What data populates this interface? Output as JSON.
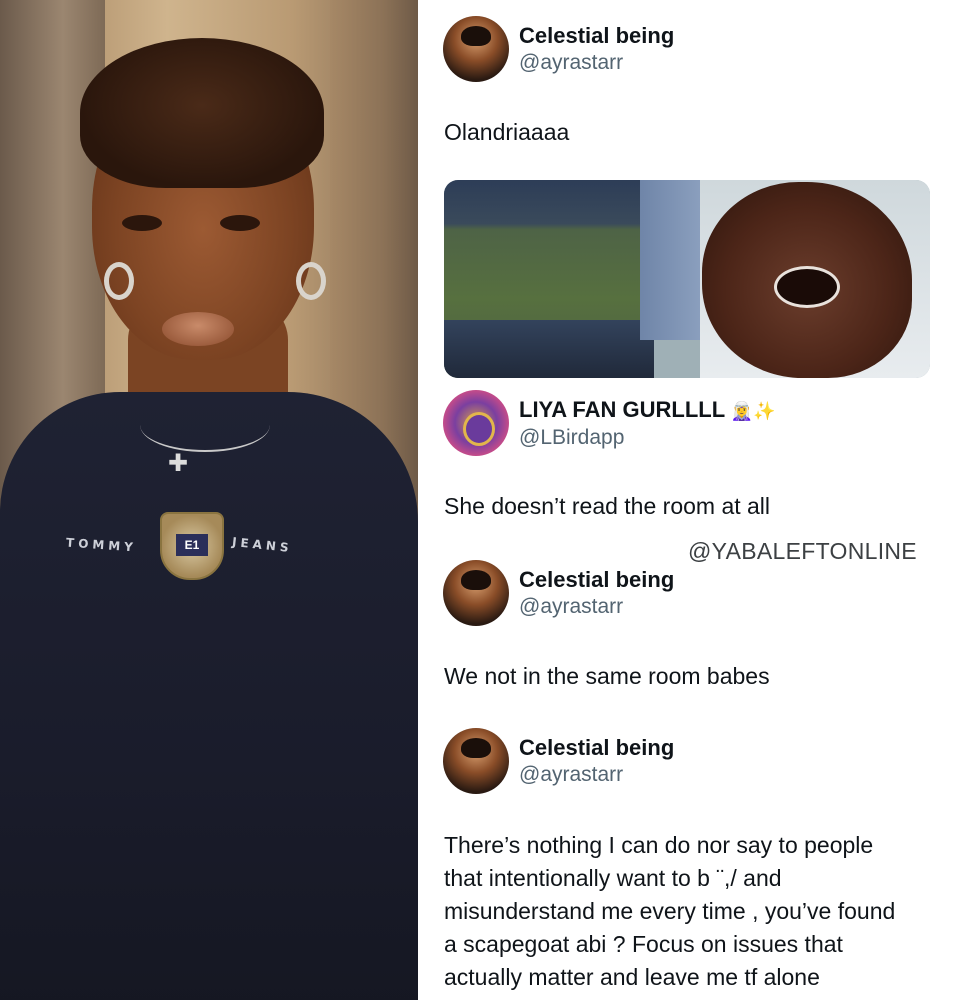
{
  "tweets": [
    {
      "display_name": "Celestial being",
      "handle": "@ayrastarr",
      "text": "Olandriaaaa",
      "avatar_icon": "profile-photo-woman"
    },
    {
      "display_name": "LIYA FAN GURLLLL",
      "badges": "🧝‍♀️✨",
      "handle": "@LBirdapp",
      "text": "She doesn’t read the room at all",
      "avatar_icon": "cartoon-character-avatar"
    },
    {
      "display_name": "Celestial being",
      "handle": "@ayrastarr",
      "text": "We not in the same room babes",
      "avatar_icon": "profile-photo-woman"
    },
    {
      "display_name": "Celestial being",
      "handle": "@ayrastarr",
      "text_lines": [
        "There’s nothing I can do nor say to people",
        "that intentionally want to b  ¨,/ and",
        "misunderstand me every time , you’ve found",
        "a scapegoat abi ? Focus on issues that",
        "actually matter and leave me tf alone"
      ],
      "avatar_icon": "profile-photo-woman"
    }
  ],
  "watermark": "@YABALEFTONLINE",
  "photo": {
    "shirt_brand_left": "TOMMY",
    "shirt_brand_right": "JEANS",
    "crest_text": "E1"
  },
  "colors": {
    "text": "#0f1419",
    "handle": "#536471",
    "shirt": "#1f2233"
  }
}
